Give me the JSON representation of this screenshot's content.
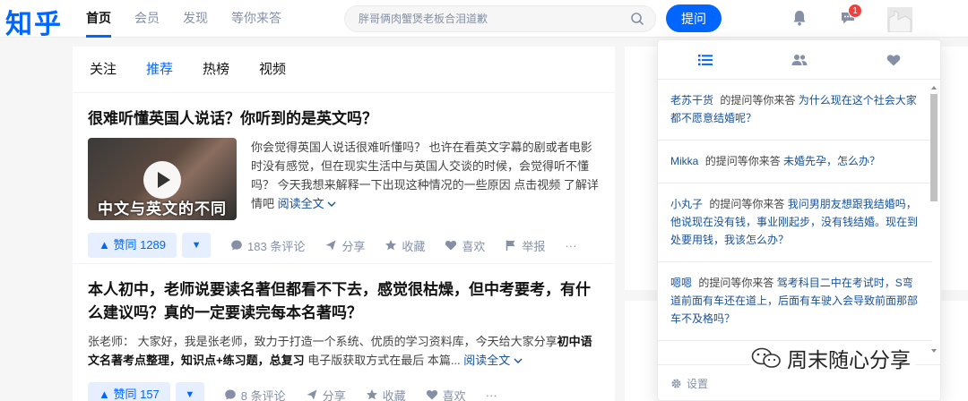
{
  "header": {
    "logo": "知乎",
    "nav": [
      "首页",
      "会员",
      "发现",
      "等你来答"
    ],
    "search_placeholder": "胖哥俩肉蟹煲老板合泪道歉",
    "ask_label": "提问",
    "notif_badge": "1"
  },
  "main": {
    "tabs": [
      "关注",
      "推荐",
      "热榜",
      "视频"
    ],
    "items": [
      {
        "title": "很难听懂英国人说话？你听到的是英文吗？",
        "thumb_caption": "中文与英文的不同",
        "excerpt": "你会觉得英国人说话很难听懂吗？ 也许在看英文字幕的剧或者电影时没有感觉，但在现实生活中与英国人交谈的时候，会觉得听不懂吗？ 今天我想来解释一下出现这种情况的一些原因 点击视频 了解详情吧",
        "read_more": "阅读全文",
        "vote": "赞同 1289",
        "comments": "183 条评论",
        "share": "分享",
        "collect": "收藏",
        "like": "喜欢",
        "report": "举报"
      },
      {
        "title": "本人初中，老师说要读名著但都看不下去，感觉很枯燥，但中考要考，有什么建议吗？真的一定要读完每本名著吗？",
        "excerpt_lead": "张老师： 大家好，我是张老师，致力于打造一个系统、优质的学习资料库，今天给大家分享",
        "excerpt_bold1": "初中语文名著考点整理，知识点+练习题，总复习",
        "excerpt_tail": " 电子版获取方式在最后 本篇...",
        "read_more": "阅读全文",
        "vote": "赞同 157",
        "comments": "8 条评论",
        "share": "分享",
        "collect": "收藏",
        "like": "喜欢"
      }
    ]
  },
  "dropdown": {
    "items": [
      {
        "user": "老苏干货",
        "action": "的提问等你来答",
        "question": "为什么现在这个社会大家都不愿意结婚呢？"
      },
      {
        "user": "Mikka",
        "action": "的提问等你来答",
        "question": "未婚先孕，怎么办？"
      },
      {
        "user": "小丸子",
        "action": "的提问等你来答",
        "question": "我问男朋友想跟我结婚吗，他说现在没有钱，事业刚起步，没有钱结婚。现在到处要用钱，我该怎么办？"
      },
      {
        "user": "嗯嗯",
        "action": "的提问等你来答",
        "question": "驾考科目二中在考试时，S弯道前面有车还在道上，后面有车驶入会导致前面那部车不及格吗？"
      }
    ],
    "settings_label": "设置"
  },
  "watermark": "周末随心分享",
  "colors": {
    "brand": "#0066ff",
    "link": "#175199",
    "muted": "#8590a6"
  }
}
